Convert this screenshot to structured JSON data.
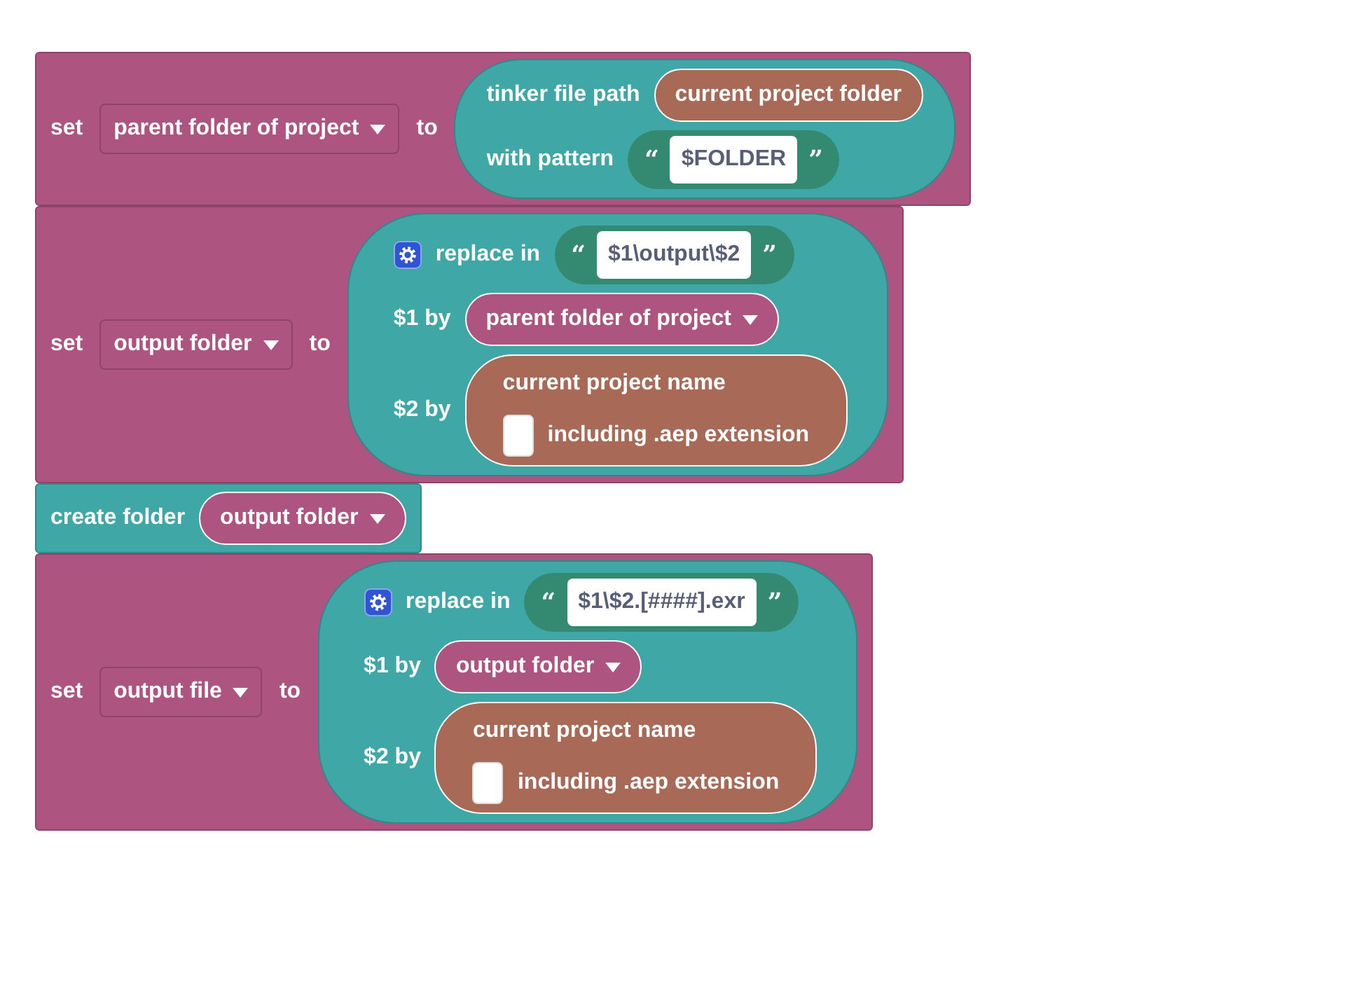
{
  "blocks": [
    {
      "kind": "set",
      "label": "set",
      "variable": "parent folder of project",
      "to": "to",
      "value": {
        "kind": "file_path",
        "lines": [
          {
            "label": "tinker file path",
            "input": {
              "kind": "reporter",
              "text": "current project folder"
            }
          },
          {
            "label": "with pattern",
            "input": {
              "kind": "string",
              "open": "“",
              "text": "$FOLDER",
              "close": "”"
            }
          }
        ]
      }
    },
    {
      "kind": "set",
      "label": "set",
      "variable": "output folder",
      "to": "to",
      "value": {
        "kind": "replace",
        "label": "replace in",
        "string": {
          "kind": "string",
          "open": "“",
          "text": "$1\\output\\$2",
          "close": "”"
        },
        "rows": [
          {
            "label": "$1 by",
            "input": {
              "kind": "variable",
              "text": "parent folder of project"
            }
          },
          {
            "label": "$2 by",
            "input": {
              "kind": "project_name",
              "title": "current project name",
              "checkbox": {
                "checked": false,
                "label": "including .aep extension"
              }
            }
          }
        ]
      }
    },
    {
      "kind": "create",
      "label": "create folder",
      "input": {
        "kind": "variable",
        "text": "output folder"
      }
    },
    {
      "kind": "set",
      "label": "set",
      "variable": "output file",
      "to": "to",
      "value": {
        "kind": "replace",
        "label": "replace in",
        "string": {
          "kind": "string",
          "open": "“",
          "text": "$1\\$2.[####].exr",
          "close": "”"
        },
        "rows": [
          {
            "label": "$1 by",
            "input": {
              "kind": "variable",
              "text": "output folder"
            }
          },
          {
            "label": "$2 by",
            "input": {
              "kind": "project_name",
              "title": "current project name",
              "checkbox": {
                "checked": false,
                "label": "including .aep extension"
              }
            }
          }
        ]
      }
    }
  ]
}
